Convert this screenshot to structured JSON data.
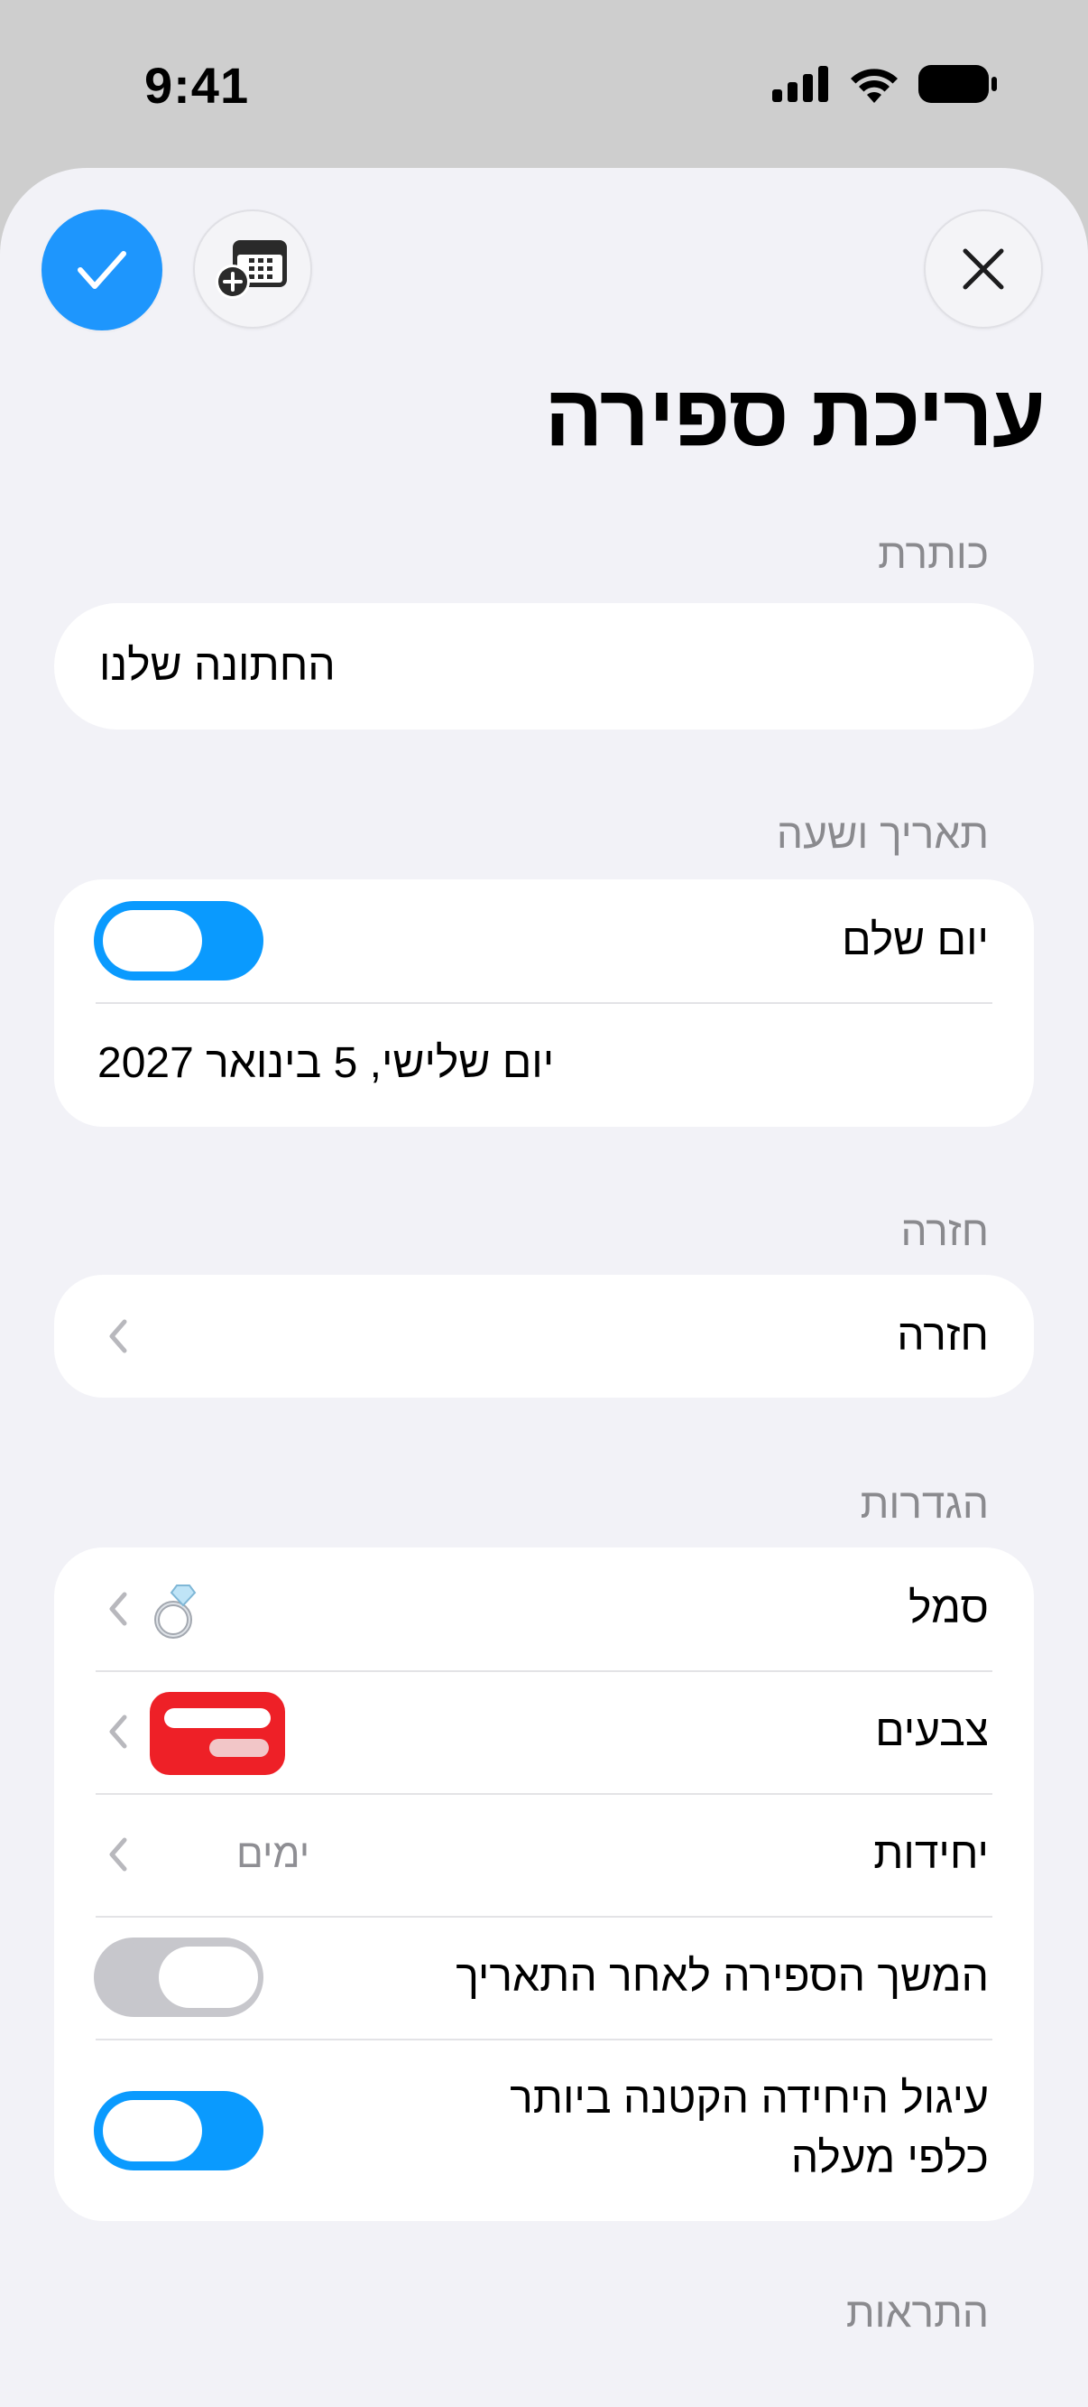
{
  "status_bar": {
    "time": "9:41",
    "icons": [
      "cellular-signal-icon",
      "wifi-icon",
      "battery-icon"
    ]
  },
  "toolbar": {
    "confirm_icon": "checkmark-icon",
    "calendar_icon": "calendar-add-icon",
    "close_icon": "close-icon"
  },
  "page": {
    "title": "עריכת ספירה"
  },
  "sections": {
    "title_header": "כותרת",
    "title_value": "החתונה שלנו",
    "datetime_header": "תאריך ושעה",
    "all_day_label": "יום שלם",
    "all_day_on": true,
    "date_value": "יום שלישי, 5 בינואר 2027",
    "repeat_header": "חזרה",
    "repeat_label": "חזרה",
    "settings_header": "הגדרות",
    "symbol_label": "סמל",
    "symbol_icon": "ring-icon",
    "colors_label": "צבעים",
    "color_accent": "#EE2027",
    "units_label": "יחידות",
    "units_value": "ימים",
    "continue_label": "המשך הספירה לאחר התאריך",
    "continue_on": false,
    "round_label_line1": "עיגול היחידה הקטנה ביותר",
    "round_label_line2": "כלפי מעלה",
    "round_on": true,
    "notifications_header": "התראות"
  },
  "colors": {
    "accent": "#1E96FD",
    "toggle_on": "#0A9AFE",
    "toggle_off": "#C7C7CC",
    "sheet_background": "#F2F2F7"
  }
}
